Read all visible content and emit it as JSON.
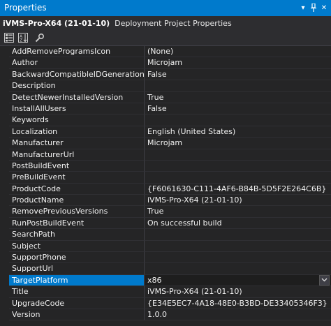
{
  "window": {
    "title": "Properties",
    "buttons": [
      {
        "name": "dropdown-arrow-icon",
        "glyph": "▾"
      },
      {
        "name": "pin-icon",
        "glyph": "⊥"
      },
      {
        "name": "close-icon",
        "glyph": "✕"
      }
    ]
  },
  "object": {
    "name": "iVMS-Pro-X64 (21-01-10)",
    "type": "Deployment Project Properties"
  },
  "toolbar": {
    "tools": [
      "categorized-icon",
      "alphabetical-icon",
      "property-pages-icon"
    ]
  },
  "properties": [
    {
      "name": "AddRemoveProgramsIcon",
      "value": "(None)"
    },
    {
      "name": "Author",
      "value": "Microjam"
    },
    {
      "name": "BackwardCompatibleIDGeneration",
      "value": "False"
    },
    {
      "name": "Description",
      "value": ""
    },
    {
      "name": "DetectNewerInstalledVersion",
      "value": "True"
    },
    {
      "name": "InstallAllUsers",
      "value": "False"
    },
    {
      "name": "Keywords",
      "value": ""
    },
    {
      "name": "Localization",
      "value": "English (United States)"
    },
    {
      "name": "Manufacturer",
      "value": "Microjam"
    },
    {
      "name": "ManufacturerUrl",
      "value": ""
    },
    {
      "name": "PostBuildEvent",
      "value": ""
    },
    {
      "name": "PreBuildEvent",
      "value": ""
    },
    {
      "name": "ProductCode",
      "value": "{F6061630-C111-4AF6-B84B-5D5F2E264C6B}"
    },
    {
      "name": "ProductName",
      "value": "iVMS-Pro-X64 (21-01-10)"
    },
    {
      "name": "RemovePreviousVersions",
      "value": "True"
    },
    {
      "name": "RunPostBuildEvent",
      "value": "On successful build"
    },
    {
      "name": "SearchPath",
      "value": ""
    },
    {
      "name": "Subject",
      "value": ""
    },
    {
      "name": "SupportPhone",
      "value": ""
    },
    {
      "name": "SupportUrl",
      "value": ""
    },
    {
      "name": "TargetPlatform",
      "value": "x86",
      "selected": true
    },
    {
      "name": "Title",
      "value": "iVMS-Pro-X64 (21-01-10)"
    },
    {
      "name": "UpgradeCode",
      "value": "{E34E5EC7-4A18-48E0-B3BD-DE33405346F3}"
    },
    {
      "name": "Version",
      "value": "1.0.0"
    }
  ],
  "colors": {
    "titlebar": "#007acc",
    "background": "#252526",
    "selected_name": "#007acc"
  }
}
